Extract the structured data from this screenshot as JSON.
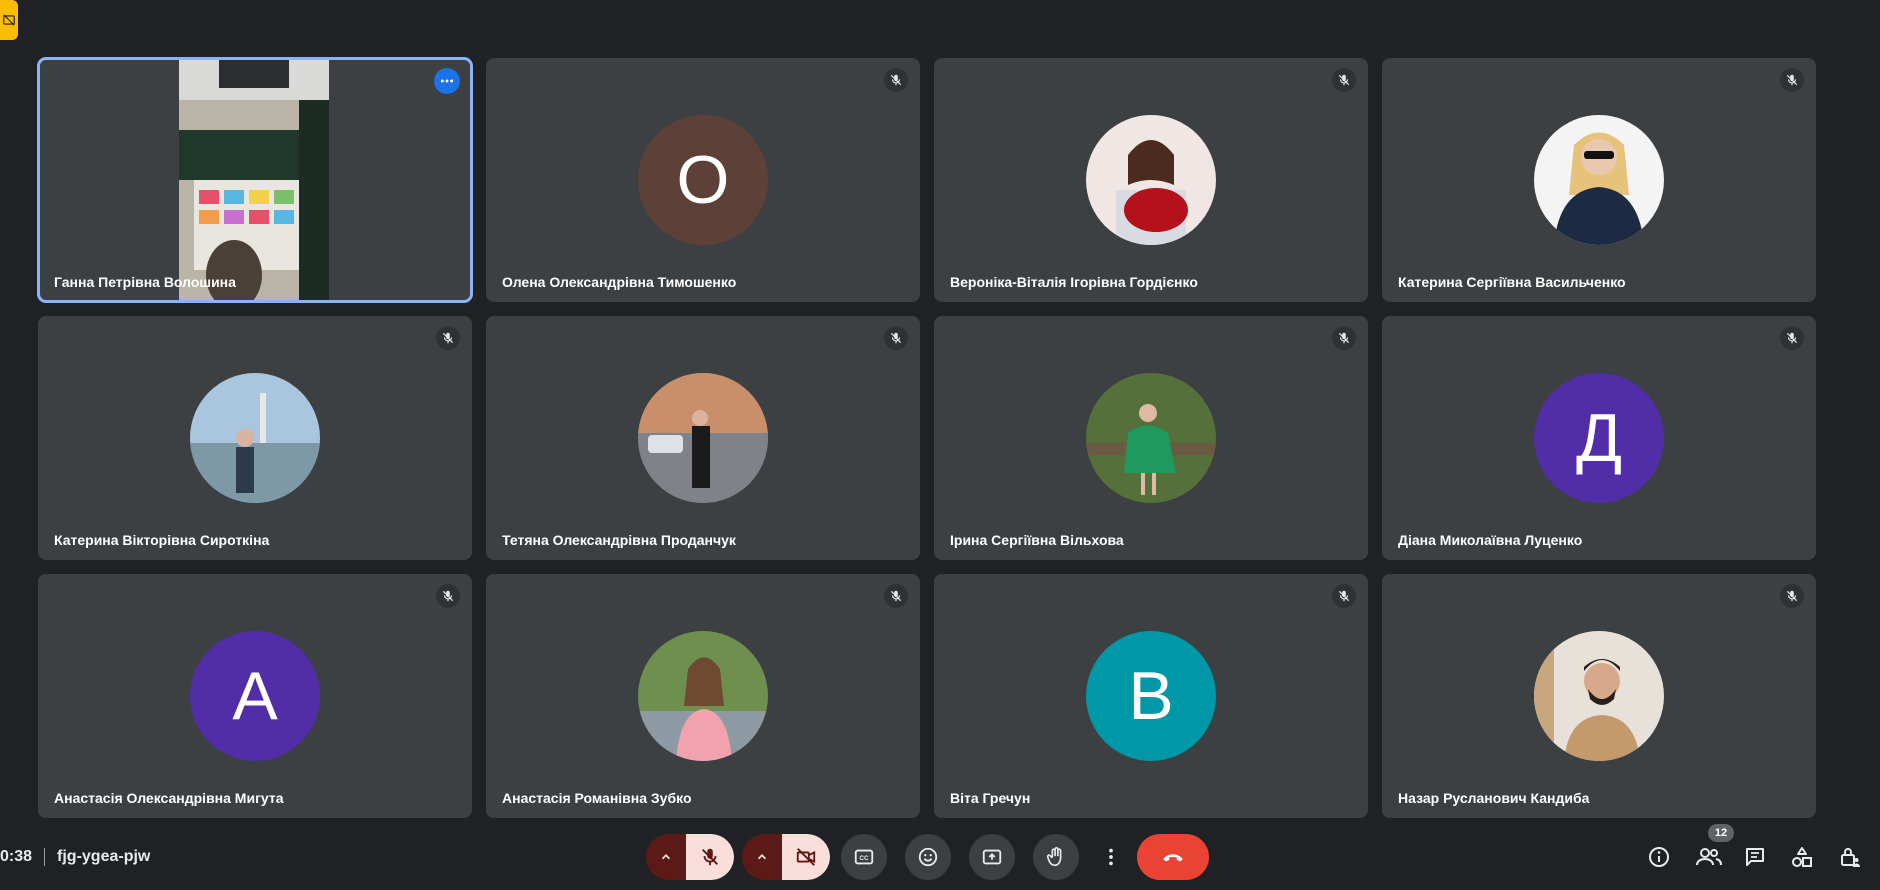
{
  "meeting": {
    "time": "0:38",
    "code": "fjg-ygea-pjw"
  },
  "participants": [
    {
      "name": "Ганна Петрівна Волошина",
      "initial": "",
      "avatar_color": "",
      "active_speaker": true
    },
    {
      "name": "Олена Олександрівна Тимошенко",
      "initial": "O",
      "avatar_color": "#5d4037"
    },
    {
      "name": "Вероніка-Віталія Ігорівна Гордієнко",
      "initial": "",
      "avatar_color": "#e8d6d0"
    },
    {
      "name": "Катерина Сергіївна Васильченко",
      "initial": "",
      "avatar_color": "#1d2a44"
    },
    {
      "name": "Катерина Вікторівна Сироткіна",
      "initial": "",
      "avatar_color": "#8fb3cf"
    },
    {
      "name": "Тетяна Олександрівна Проданчук",
      "initial": "",
      "avatar_color": "#a6715a"
    },
    {
      "name": "Ірина Сергіївна Вільхова",
      "initial": "",
      "avatar_color": "#5d7a3c"
    },
    {
      "name": "Діана Миколаївна Луценко",
      "initial": "Д",
      "avatar_color": "#512da8"
    },
    {
      "name": "Анастасія Олександрівна Мигута",
      "initial": "A",
      "avatar_color": "#512da8"
    },
    {
      "name": "Анастасія Романівна Зубко",
      "initial": "",
      "avatar_color": "#6e8f4e"
    },
    {
      "name": "Віта Гречун",
      "initial": "B",
      "avatar_color": "#0097a7"
    },
    {
      "name": "Назар Русланович Кандиба",
      "initial": "",
      "avatar_color": "#e7e1d9"
    }
  ],
  "people_count": "12",
  "colors": {
    "background": "#202124",
    "tile": "#3c4043",
    "active_outline": "#8ab4f8",
    "hangup": "#ea4335",
    "muted_control": "#f9dedc",
    "badge": "#fbbc04"
  },
  "icons": {
    "mic_off": "mic-off-icon",
    "camera_off": "videocam-off-icon",
    "captions": "closed-caption-icon",
    "emoji": "emoji-icon",
    "present": "present-screen-icon",
    "hand": "raise-hand-icon",
    "more": "more-vert-icon",
    "hangup": "call-end-icon",
    "info": "info-icon",
    "people": "people-icon",
    "chat": "chat-icon",
    "activities": "activities-icon",
    "host_controls": "lock-person-icon"
  }
}
